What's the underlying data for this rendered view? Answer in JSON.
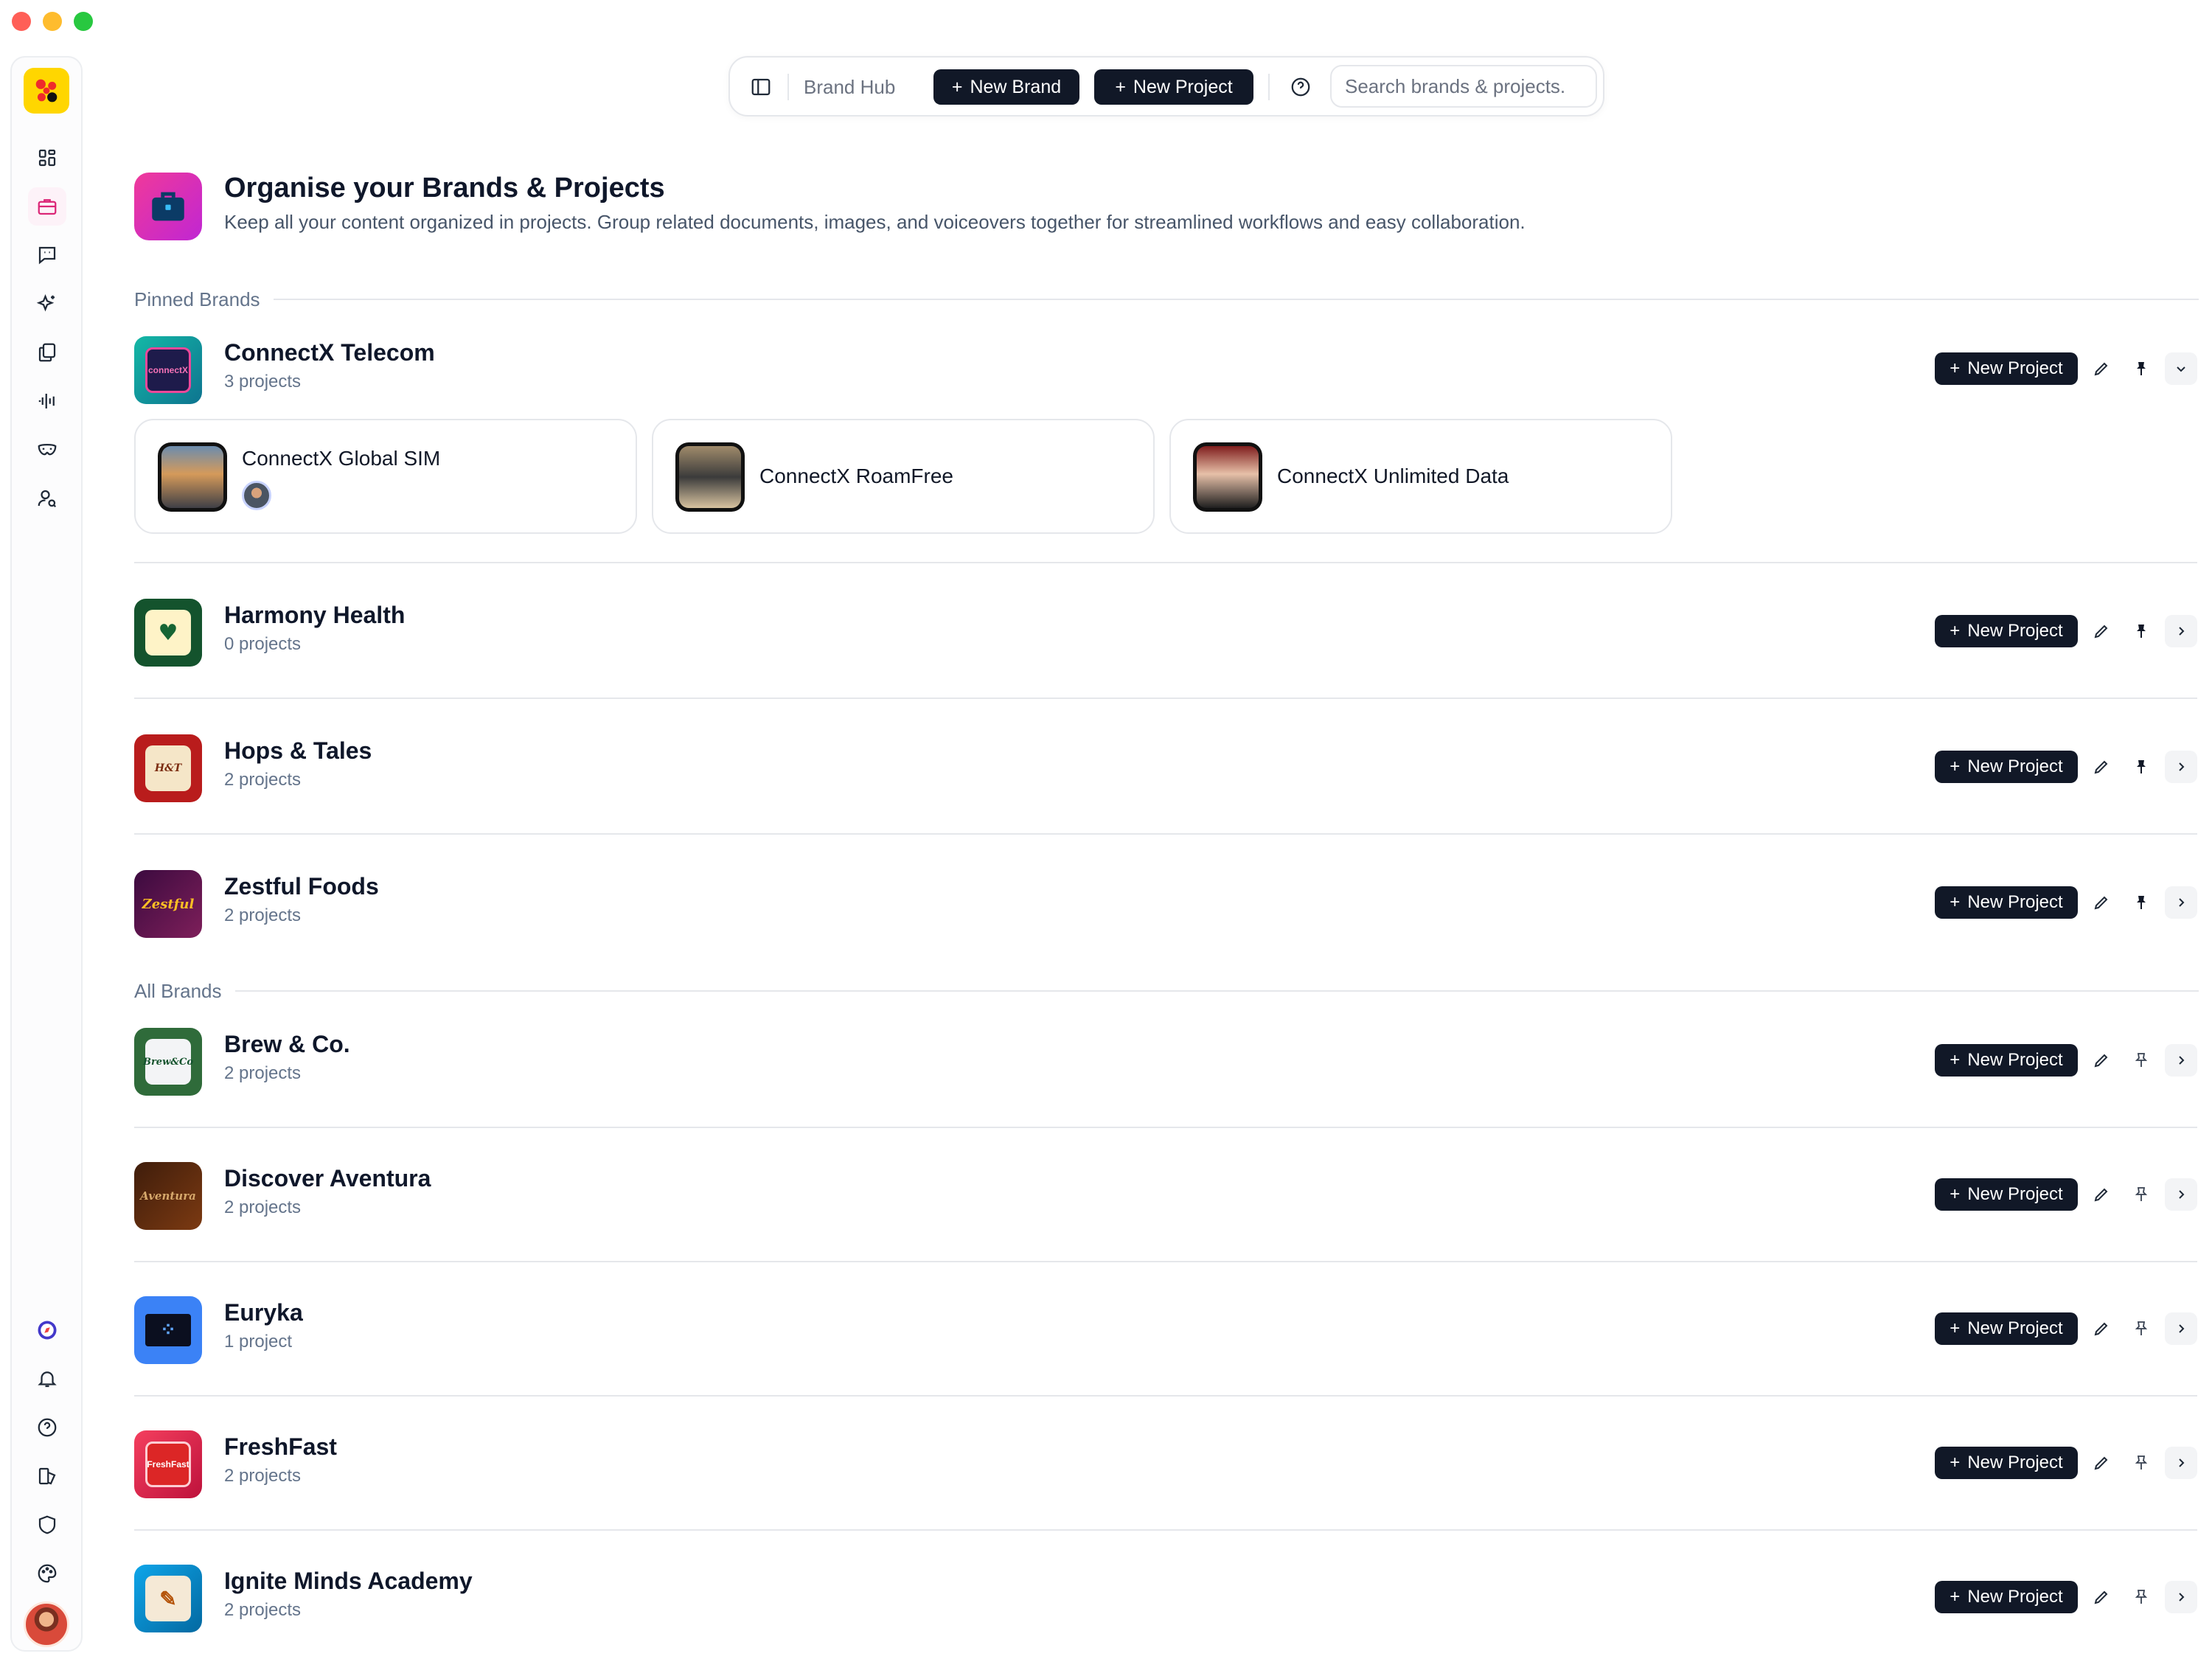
{
  "toolbar": {
    "brand_hub": "Brand Hub",
    "new_brand": "New Brand",
    "new_project": "New Project",
    "search_placeholder": "Search brands & projects."
  },
  "header": {
    "title": "Organise your Brands & Projects",
    "subtitle": "Keep all your content organized in projects. Group related documents, images, and voiceovers together for streamlined workflows and easy collaboration."
  },
  "sidebar": {
    "top_icons": [
      "dashboard-icon",
      "briefcase-icon",
      "chat-icon",
      "sparkles-icon",
      "documents-icon",
      "audio-wave-icon",
      "mask-icon",
      "user-search-icon"
    ],
    "bottom_icons": [
      "compass-icon",
      "bell-icon",
      "help-icon",
      "layers-icon",
      "shield-icon",
      "palette-icon"
    ],
    "active_item": "briefcase-icon"
  },
  "sections": {
    "pinned": "Pinned Brands",
    "all": "All Brands"
  },
  "row_action_label": "New Project",
  "pinned_brands": [
    {
      "name": "ConnectX Telecom",
      "count": "3 projects",
      "expanded": true,
      "pinned": true
    },
    {
      "name": "Harmony Health",
      "count": "0 projects",
      "expanded": false,
      "pinned": true
    },
    {
      "name": "Hops & Tales",
      "count": "2 projects",
      "expanded": false,
      "pinned": true
    },
    {
      "name": "Zestful Foods",
      "count": "2 projects",
      "expanded": false,
      "pinned": true
    }
  ],
  "connectx_projects": [
    {
      "name": "ConnectX Global SIM",
      "has_avatar": true
    },
    {
      "name": "ConnectX RoamFree",
      "has_avatar": false
    },
    {
      "name": "ConnectX Unlimited Data",
      "has_avatar": false
    }
  ],
  "all_brands": [
    {
      "name": "Brew & Co.",
      "count": "2 projects",
      "pinned": false
    },
    {
      "name": "Discover Aventura",
      "count": "2 projects",
      "pinned": false
    },
    {
      "name": "Euryka",
      "count": "1 project",
      "pinned": false
    },
    {
      "name": "FreshFast",
      "count": "2 projects",
      "pinned": false
    },
    {
      "name": "Ignite Minds Academy",
      "count": "2 projects",
      "pinned": false
    }
  ],
  "colors": {
    "primary_button": "#111827",
    "accent_pink": "#db2777",
    "logo_yellow": "#ffd600"
  }
}
